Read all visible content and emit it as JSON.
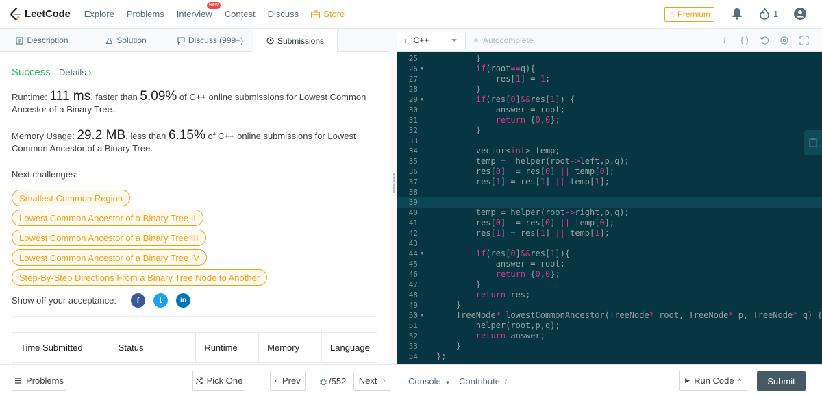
{
  "nav": {
    "logo_text": "LeetCode",
    "links": [
      "Explore",
      "Problems",
      "Interview",
      "Contest",
      "Discuss",
      "Store"
    ],
    "new_badge": "New",
    "premium": "Premium",
    "streak_count": "1"
  },
  "tabs": {
    "description": "Description",
    "solution": "Solution",
    "discuss": "Discuss (999+)",
    "submissions": "Submissions"
  },
  "result": {
    "status": "Success",
    "details": "Details ›",
    "runtime_label": "Runtime: ",
    "runtime_value": "111 ms",
    "runtime_mid": ", faster than ",
    "runtime_pct": "5.09%",
    "runtime_tail": " of C++ online submissions for Lowest Common Ancestor of a Binary Tree.",
    "memory_label": "Memory Usage: ",
    "memory_value": "29.2 MB",
    "memory_mid": ", less than ",
    "memory_pct": "6.15%",
    "memory_tail": " of C++ online submissions for Lowest Common Ancestor of a Binary Tree."
  },
  "next_challenges": {
    "label": "Next challenges:",
    "items": [
      "Smallest Common Region",
      "Lowest Common Ancestor of a Binary Tree II",
      "Lowest Common Ancestor of a Binary Tree III",
      "Lowest Common Ancestor of a Binary Tree IV",
      "Step-By-Step Directions From a Binary Tree Node to Another"
    ]
  },
  "share": {
    "label": "Show off your acceptance:",
    "facebook": "f",
    "twitter": "t",
    "linkedin": "in"
  },
  "table": {
    "headers": [
      "Time Submitted",
      "Status",
      "Runtime",
      "Memory",
      "Language"
    ]
  },
  "editor": {
    "language": "C++",
    "autocomplete": "Autocomplete",
    "lines": [
      {
        "n": "25",
        "fold": false,
        "code": "        }"
      },
      {
        "n": "26",
        "fold": true,
        "code": "        if(root==q){"
      },
      {
        "n": "27",
        "fold": false,
        "code": "            res[1] = 1;"
      },
      {
        "n": "28",
        "fold": false,
        "code": "        }"
      },
      {
        "n": "29",
        "fold": true,
        "code": "        if(res[0]&&res[1]) {"
      },
      {
        "n": "30",
        "fold": false,
        "code": "            answer = root;"
      },
      {
        "n": "31",
        "fold": false,
        "code": "            return {0,0};"
      },
      {
        "n": "32",
        "fold": false,
        "code": "        }"
      },
      {
        "n": "33",
        "fold": false,
        "code": ""
      },
      {
        "n": "34",
        "fold": false,
        "code": "        vector<int> temp;"
      },
      {
        "n": "35",
        "fold": false,
        "code": "        temp =  helper(root->left,p,q);"
      },
      {
        "n": "36",
        "fold": false,
        "code": "        res[0]  = res[0] || temp[0];"
      },
      {
        "n": "37",
        "fold": false,
        "code": "        res[1] = res[1] || temp[1];"
      },
      {
        "n": "38",
        "fold": false,
        "code": ""
      },
      {
        "n": "39",
        "fold": false,
        "code": ""
      },
      {
        "n": "40",
        "fold": false,
        "code": "        temp = helper(root->right,p,q);"
      },
      {
        "n": "41",
        "fold": false,
        "code": "        res[0]  = res[0] || temp[0];"
      },
      {
        "n": "42",
        "fold": false,
        "code": "        res[1] = res[1] || temp[1];"
      },
      {
        "n": "43",
        "fold": false,
        "code": ""
      },
      {
        "n": "44",
        "fold": true,
        "code": "        if(res[0]&&res[1]){"
      },
      {
        "n": "45",
        "fold": false,
        "code": "            answer = root;"
      },
      {
        "n": "46",
        "fold": false,
        "code": "            return {0,0};"
      },
      {
        "n": "47",
        "fold": false,
        "code": "        }"
      },
      {
        "n": "48",
        "fold": false,
        "code": "        return res;"
      },
      {
        "n": "49",
        "fold": false,
        "code": "    }"
      },
      {
        "n": "50",
        "fold": true,
        "code": "    TreeNode* lowestCommonAncestor(TreeNode* root, TreeNode* p, TreeNode* q) {"
      },
      {
        "n": "51",
        "fold": false,
        "code": "        helper(root,p,q);"
      },
      {
        "n": "52",
        "fold": false,
        "code": "        return answer;"
      },
      {
        "n": "53",
        "fold": false,
        "code": "    }"
      },
      {
        "n": "54",
        "fold": false,
        "code": "};"
      }
    ],
    "highlight_line": "39"
  },
  "bottom": {
    "problems": "Problems",
    "pick_one": "Pick One",
    "prev": "Prev",
    "page": "/552",
    "next": "Next",
    "console": "Console",
    "contribute": "Contribute",
    "run_code": "Run Code",
    "submit": "Submit"
  },
  "colors": {
    "success": "#2db55d",
    "accent_orange": "#f0a020",
    "editor_bg": "#073642",
    "keyword": "#d33682"
  }
}
